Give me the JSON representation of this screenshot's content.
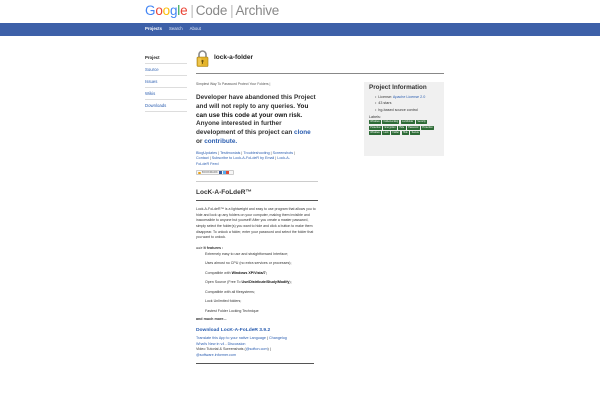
{
  "header": {
    "logo_google": "Google",
    "logo_code": "Code",
    "logo_archive": "Archive"
  },
  "nav": {
    "items": [
      "Projects",
      "Search",
      "About"
    ]
  },
  "sidebar": {
    "items": [
      {
        "label": "Project"
      },
      {
        "label": "Source"
      },
      {
        "label": "Issues"
      },
      {
        "label": "Wikis"
      },
      {
        "label": "Downloads"
      }
    ]
  },
  "project": {
    "name": "lock-a-folder",
    "tagline": "Simplest Way To Password Protect Your Folders |",
    "warning_1": "Developer have abandoned this Project and will not reply to any queries.",
    "warning_2": "You can use this code at your own risk.",
    "warning_3": "Anyone interested in further development of this project can",
    "warning_clone": "clone",
    "warning_or": "or",
    "warning_contribute": "contribute.",
    "links_line1": [
      "BlogUpdates",
      "Testimonials",
      "Troubleshooting",
      "Screenshots"
    ],
    "links_line2": [
      "Contact",
      "Subscribe to Lock-A-FoLdeR by Email",
      "Lock-A-"
    ],
    "links_line3": "FoLdeR Feed",
    "bookmark": "BOOKMARK",
    "section_title": "LocK-A-FoLdeR™",
    "description": "Lock-A-FoLdeR™ is a lightweight and easy to use program that allows you to hide and lock up any folders on your computer, making them invisible and inaccessible to anyone but yourself! After you create a master password, simply select the folder(s) you want to hide and click a button to make them disappear. To unlock a folder, enter your password and select the folder that you want to unlock.",
    "features_title": "==> It features :",
    "features": [
      {
        "text": "Extremely easy to use and straightforward Interface;",
        "bold": ""
      },
      {
        "text": "Uses almost no CPU (no extra services or processes);",
        "bold": ""
      },
      {
        "text": "Compatible with ",
        "bold": "Windows XP/Vista/7;"
      },
      {
        "text": "Open Source (Free To ",
        "bold": "Use/Distribute/Study/Modify"
      },
      {
        "text": "Compatible with all filesystems;",
        "bold": ""
      },
      {
        "text": "Lock Unlimited folders;",
        "bold": ""
      },
      {
        "text": "Fastest Folder Locking Technique",
        "bold": ""
      }
    ],
    "features_tail_3": "",
    "features_tail_4": ");",
    "and_more": "and much more...",
    "download": "Download LocK-A-FoLdeR 3.9.2",
    "translate_a": "Translate this App to your native Language",
    "translate_b": "Changelog",
    "whatsnew_a": "What's New in v4",
    "whatsnew_b": "Discussion",
    "video_a": "Video Tutorial & Screenshots (",
    "video_link": "@softon.com",
    "video_b": ") |",
    "video_c": "@software.informer.com"
  },
  "info": {
    "title": "Project Information",
    "license_label": "License: ",
    "license": "Apache License 2.0",
    "stars": "43 stars",
    "vcs": "hg-based source control",
    "labels_title": "Labels:",
    "labels": [
      "Windows",
      "FolderLocking",
      "LockFolder",
      "Security",
      "Protection",
      "Encryption",
      "Hide",
      "Password",
      "Protection",
      "Windows",
      "Lock",
      "Folder",
      "Hide",
      "Secure"
    ]
  },
  "colors": {
    "nav_bg": "#3d60a8",
    "link": "#2a5db0",
    "label_bg": "#2d6b36"
  }
}
